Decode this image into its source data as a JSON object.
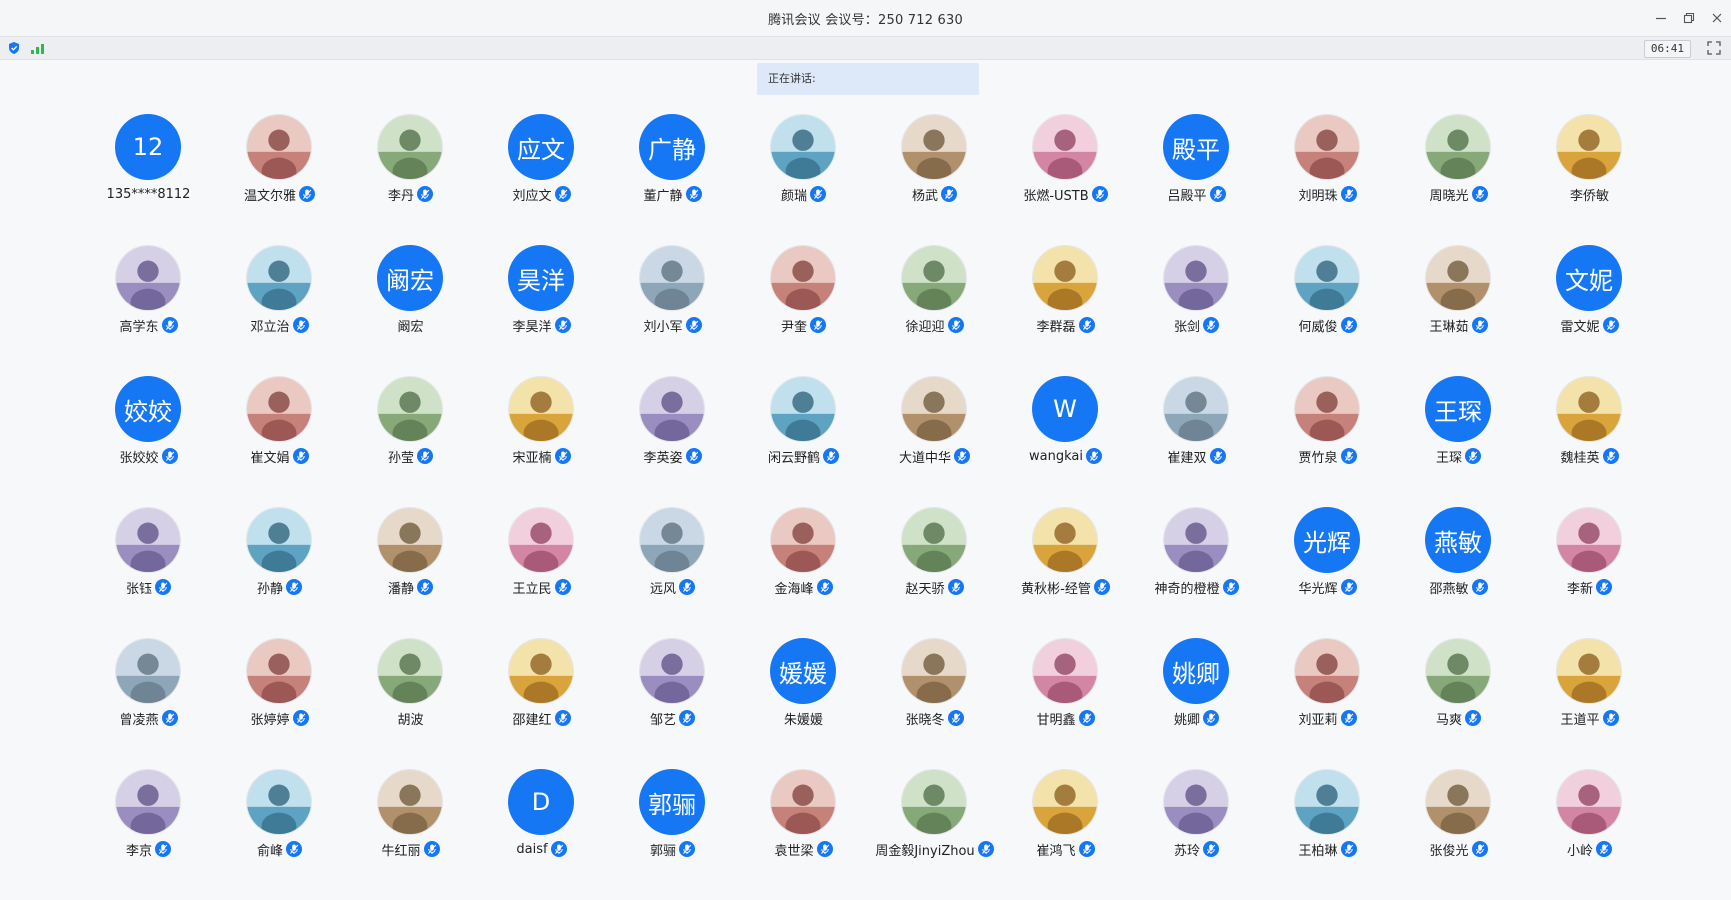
{
  "window": {
    "title": "腾讯会议 会议号：250 712 630",
    "controls": [
      "minimize-icon",
      "restore-icon",
      "close-icon"
    ]
  },
  "toolbar": {
    "security_icon": "shield-icon",
    "network_icon": "signal-icon",
    "timer": "06:41",
    "fullscreen_icon": "fullscreen-icon"
  },
  "speaking": {
    "label": "正在讲话:"
  },
  "colors": {
    "accent": "#1677f5",
    "speaking_bg": "#dde8f9"
  },
  "participants": [
    {
      "name": "135****8112",
      "avatar_text": "12",
      "mic": false
    },
    {
      "name": "温文尔雅",
      "avatar_text": "",
      "mic": true
    },
    {
      "name": "李丹",
      "avatar_text": "",
      "mic": true
    },
    {
      "name": "刘应文",
      "avatar_text": "应文",
      "mic": true
    },
    {
      "name": "董广静",
      "avatar_text": "广静",
      "mic": true
    },
    {
      "name": "颜瑞",
      "avatar_text": "",
      "mic": true
    },
    {
      "name": "杨武",
      "avatar_text": "",
      "mic": true
    },
    {
      "name": "张燃-USTB",
      "avatar_text": "",
      "mic": true
    },
    {
      "name": "吕殿平",
      "avatar_text": "殿平",
      "mic": true
    },
    {
      "name": "刘明珠",
      "avatar_text": "",
      "mic": true
    },
    {
      "name": "周晓光",
      "avatar_text": "",
      "mic": true
    },
    {
      "name": "李侨敏",
      "avatar_text": "",
      "mic": false
    },
    {
      "name": "高学东",
      "avatar_text": "",
      "mic": true
    },
    {
      "name": "邓立治",
      "avatar_text": "",
      "mic": true
    },
    {
      "name": "阚宏",
      "avatar_text": "阚宏",
      "mic": false
    },
    {
      "name": "李昊洋",
      "avatar_text": "昊洋",
      "mic": true
    },
    {
      "name": "刘小军",
      "avatar_text": "",
      "mic": true
    },
    {
      "name": "尹奎",
      "avatar_text": "",
      "mic": true
    },
    {
      "name": "徐迎迎",
      "avatar_text": "",
      "mic": true
    },
    {
      "name": "李群磊",
      "avatar_text": "",
      "mic": true
    },
    {
      "name": "张剑",
      "avatar_text": "",
      "mic": true
    },
    {
      "name": "何威俊",
      "avatar_text": "",
      "mic": true
    },
    {
      "name": "王琳茹",
      "avatar_text": "",
      "mic": true
    },
    {
      "name": "雷文妮",
      "avatar_text": "文妮",
      "mic": true
    },
    {
      "name": "张姣姣",
      "avatar_text": "姣姣",
      "mic": true
    },
    {
      "name": "崔文娟",
      "avatar_text": "",
      "mic": true
    },
    {
      "name": "孙莹",
      "avatar_text": "",
      "mic": true
    },
    {
      "name": "宋亚楠",
      "avatar_text": "",
      "mic": true
    },
    {
      "name": "李英姿",
      "avatar_text": "",
      "mic": true
    },
    {
      "name": "闲云野鹤",
      "avatar_text": "",
      "mic": true
    },
    {
      "name": "大道中华",
      "avatar_text": "",
      "mic": true
    },
    {
      "name": "wangkai",
      "avatar_text": "W",
      "mic": true
    },
    {
      "name": "崔建双",
      "avatar_text": "",
      "mic": true
    },
    {
      "name": "贾竹泉",
      "avatar_text": "",
      "mic": true
    },
    {
      "name": "王琛",
      "avatar_text": "王琛",
      "mic": true
    },
    {
      "name": "魏桂英",
      "avatar_text": "",
      "mic": true
    },
    {
      "name": "张钰",
      "avatar_text": "",
      "mic": true
    },
    {
      "name": "孙静",
      "avatar_text": "",
      "mic": true
    },
    {
      "name": "潘静",
      "avatar_text": "",
      "mic": true
    },
    {
      "name": "王立民",
      "avatar_text": "",
      "mic": true
    },
    {
      "name": "远风",
      "avatar_text": "",
      "mic": true
    },
    {
      "name": "金海峰",
      "avatar_text": "",
      "mic": true
    },
    {
      "name": "赵天骄",
      "avatar_text": "",
      "mic": true
    },
    {
      "name": "黄秋彬-经管",
      "avatar_text": "",
      "mic": true
    },
    {
      "name": "神奇的橙橙",
      "avatar_text": "",
      "mic": true
    },
    {
      "name": "华光辉",
      "avatar_text": "光辉",
      "mic": true
    },
    {
      "name": "邵燕敏",
      "avatar_text": "燕敏",
      "mic": true
    },
    {
      "name": "李新",
      "avatar_text": "",
      "mic": true
    },
    {
      "name": "曾凌燕",
      "avatar_text": "",
      "mic": true
    },
    {
      "name": "张婷婷",
      "avatar_text": "",
      "mic": true
    },
    {
      "name": "胡波",
      "avatar_text": "",
      "mic": false
    },
    {
      "name": "邵建红",
      "avatar_text": "",
      "mic": true
    },
    {
      "name": "邹艺",
      "avatar_text": "",
      "mic": true
    },
    {
      "name": "朱媛媛",
      "avatar_text": "媛媛",
      "mic": false
    },
    {
      "name": "张晓冬",
      "avatar_text": "",
      "mic": true
    },
    {
      "name": "甘明鑫",
      "avatar_text": "",
      "mic": true
    },
    {
      "name": "姚卿",
      "avatar_text": "姚卿",
      "mic": true
    },
    {
      "name": "刘亚莉",
      "avatar_text": "",
      "mic": true
    },
    {
      "name": "马爽",
      "avatar_text": "",
      "mic": true
    },
    {
      "name": "王道平",
      "avatar_text": "",
      "mic": true
    },
    {
      "name": "李京",
      "avatar_text": "",
      "mic": true
    },
    {
      "name": "俞峰",
      "avatar_text": "",
      "mic": true
    },
    {
      "name": "牛红丽",
      "avatar_text": "",
      "mic": true
    },
    {
      "name": "daisf",
      "avatar_text": "D",
      "mic": true
    },
    {
      "name": "郭骊",
      "avatar_text": "郭骊",
      "mic": true
    },
    {
      "name": "袁世梁",
      "avatar_text": "",
      "mic": true
    },
    {
      "name": "周金毅JinyiZhou",
      "avatar_text": "",
      "mic": true
    },
    {
      "name": "崔鸿飞",
      "avatar_text": "",
      "mic": true
    },
    {
      "name": "苏玲",
      "avatar_text": "",
      "mic": true
    },
    {
      "name": "王柏琳",
      "avatar_text": "",
      "mic": true
    },
    {
      "name": "张俊光",
      "avatar_text": "",
      "mic": true
    },
    {
      "name": "小岭",
      "avatar_text": "",
      "mic": true
    }
  ]
}
